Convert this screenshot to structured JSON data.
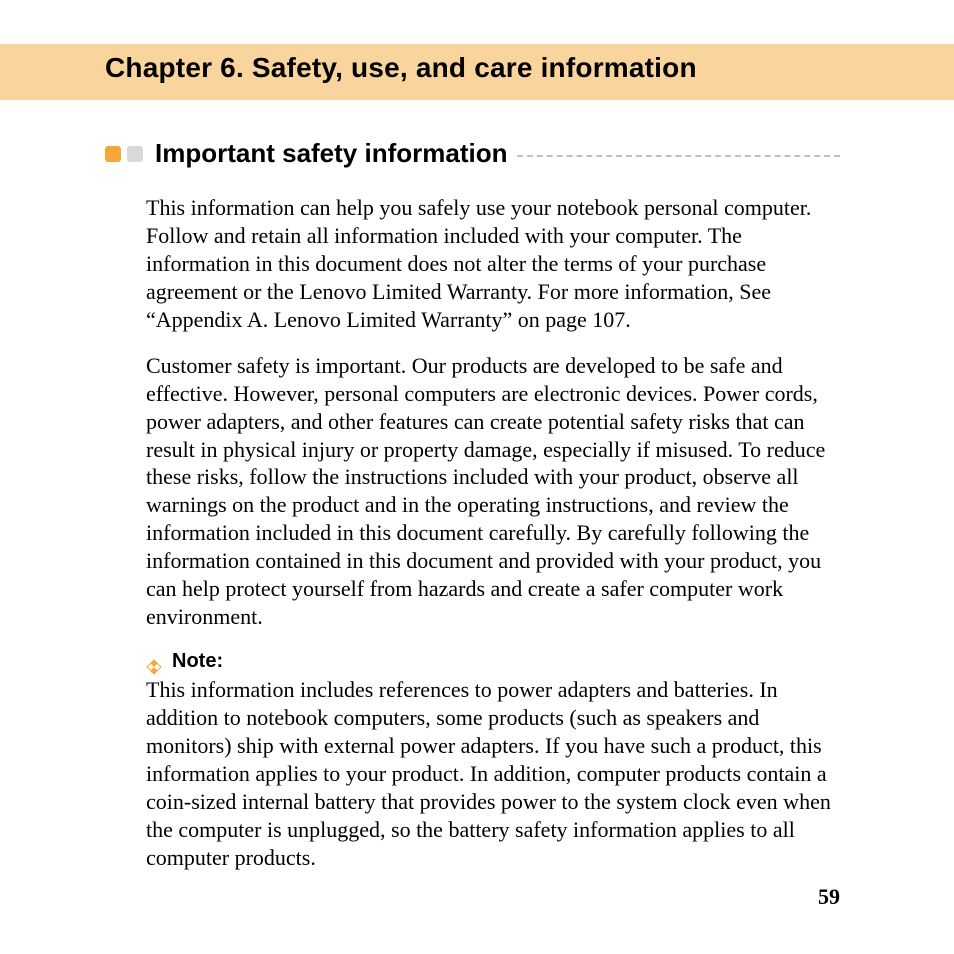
{
  "chapter": {
    "title": "Chapter 6. Safety, use, and care information"
  },
  "section": {
    "title": "Important safety information"
  },
  "paragraphs": {
    "p1": "This information can help you safely use your notebook personal computer. Follow and retain all information included with your computer. The information in this document does not alter the terms of your purchase agreement or the Lenovo Limited Warranty. For more information, See “Appendix A. Lenovo Limited Warranty” on page 107.",
    "p2": "Customer safety is important. Our products are developed to be safe and effective. However, personal computers are electronic devices. Power cords, power adapters, and other features can create potential safety risks that can result in physical injury or property damage, especially if misused. To reduce these risks, follow the instructions included with your product, observe all warnings on the product and in the operating instructions, and review the information included in this document carefully. By carefully following the information contained in this document and provided with your product, you can help protect yourself from hazards and create a safer computer work environment."
  },
  "note": {
    "label": "Note:",
    "text": "This information includes references to power adapters and batteries. In addition to notebook computers, some products (such as speakers and monitors) ship with external power adapters. If you have such a product, this information applies to your product. In addition, computer products contain a coin-sized internal battery that provides power to the system clock even when the computer is unplugged, so the battery safety information applies to all computer products."
  },
  "page_number": "59"
}
